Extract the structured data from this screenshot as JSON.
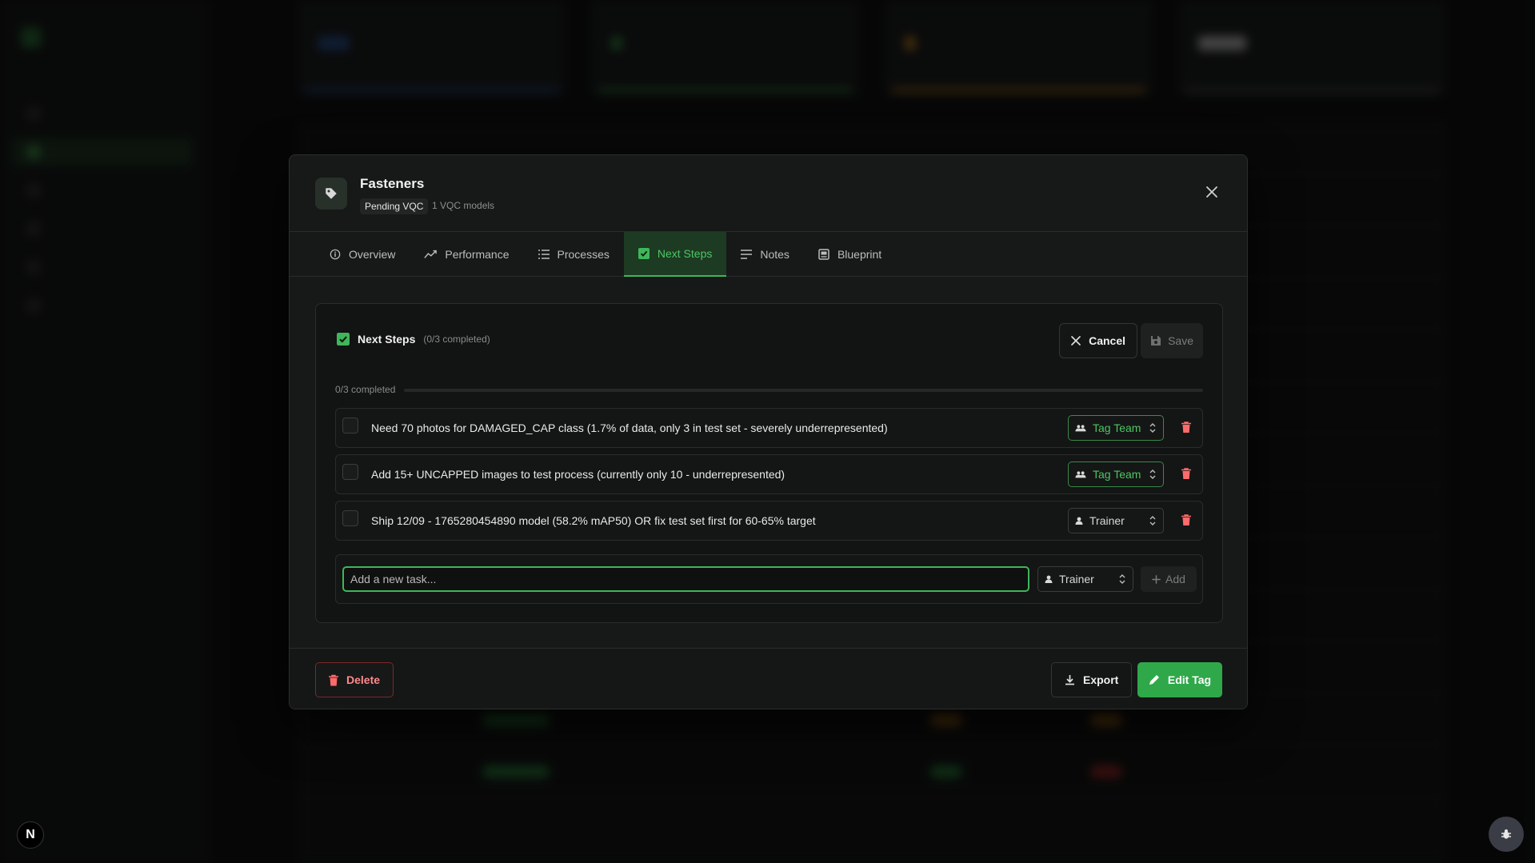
{
  "app": {
    "corner_badge": "N"
  },
  "modal": {
    "title": "Fasteners",
    "status": "Pending VQC",
    "models": "1 VQC models",
    "tabs": [
      {
        "label": "Overview",
        "icon": "info-circle-icon"
      },
      {
        "label": "Performance",
        "icon": "trend-line-icon"
      },
      {
        "label": "Processes",
        "icon": "list-icon"
      },
      {
        "label": "Next Steps",
        "icon": "check-square-icon",
        "active": true
      },
      {
        "label": "Notes",
        "icon": "notes-lines-icon"
      },
      {
        "label": "Blueprint",
        "icon": "blueprint-icon"
      }
    ]
  },
  "next_steps": {
    "title": "Next Steps",
    "subtitle": "(0/3 completed)",
    "cancel_label": "Cancel",
    "save_label": "Save",
    "progress_label": "0/3 completed",
    "progress_fraction": 0,
    "tasks": [
      {
        "text": "Need 70 photos for DAMAGED_CAP class (1.7% of data, only 3 in test set - severely underrepresented)",
        "assignee": "Tag Team",
        "team": true,
        "done": false
      },
      {
        "text": "Add 15+ UNCAPPED images to test process (currently only 10 - underrepresented)",
        "assignee": "Tag Team",
        "team": true,
        "done": false
      },
      {
        "text": "Ship 12/09 - 1765280454890 model (58.2% mAP50) OR fix test set first for 60-65% target",
        "assignee": "Trainer",
        "team": false,
        "done": false
      }
    ],
    "new_task": {
      "placeholder": "Add a new task...",
      "assignee": "Trainer",
      "add_label": "Add"
    }
  },
  "footer": {
    "delete_label": "Delete",
    "export_label": "Export",
    "edit_label": "Edit Tag"
  },
  "colors": {
    "accent": "#3fb659",
    "danger": "#ff6b6b",
    "panel": "#121313"
  }
}
